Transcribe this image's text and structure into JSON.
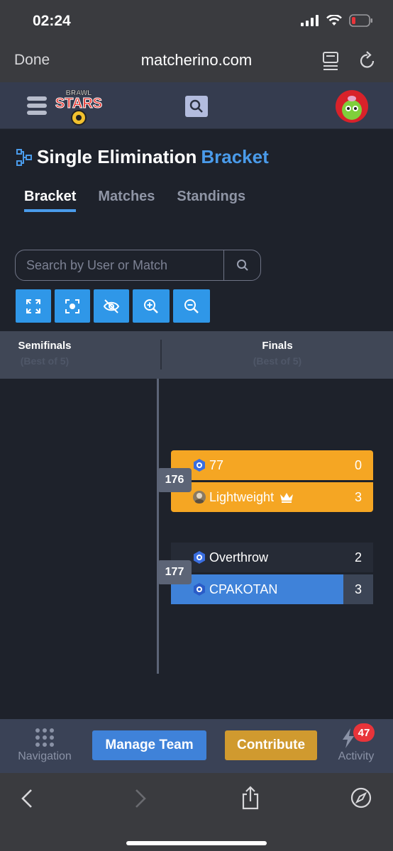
{
  "status_bar": {
    "time": "02:24"
  },
  "safari": {
    "done_label": "Done",
    "url": "matcherino.com"
  },
  "site_header": {
    "logo_text_top": "BRAWL",
    "logo_text_main": "STARS"
  },
  "page": {
    "title_part1": "Single Elimination",
    "title_part2": "Bracket"
  },
  "tabs": [
    {
      "label": "Bracket",
      "active": true
    },
    {
      "label": "Matches",
      "active": false
    },
    {
      "label": "Standings",
      "active": false
    }
  ],
  "search": {
    "placeholder": "Search by User or Match"
  },
  "tools": [
    "expand-icon",
    "focus-icon",
    "eye-off-icon",
    "zoom-in-icon",
    "zoom-out-icon"
  ],
  "rounds": [
    {
      "name": "Semifinals",
      "sub": "(Best of 5)"
    },
    {
      "name": "Finals",
      "sub": "(Best of 5)"
    }
  ],
  "matches": [
    {
      "id": "176",
      "teams": [
        {
          "name": "77",
          "score": "0"
        },
        {
          "name": "Lightweight",
          "score": "3",
          "crown": true
        }
      ]
    },
    {
      "id": "177",
      "teams": [
        {
          "name": "Overthrow",
          "score": "2"
        },
        {
          "name": "CPAKOTAN",
          "score": "3"
        }
      ]
    }
  ],
  "bottom_nav": {
    "navigation_label": "Navigation",
    "manage_team_label": "Manage Team",
    "contribute_label": "Contribute",
    "activity_label": "Activity",
    "activity_badge": "47"
  },
  "colors": {
    "accent": "#4a9bea",
    "winner_orange": "#f5a623",
    "manage_team": "#3f82d9",
    "contribute": "#d09a2f"
  }
}
